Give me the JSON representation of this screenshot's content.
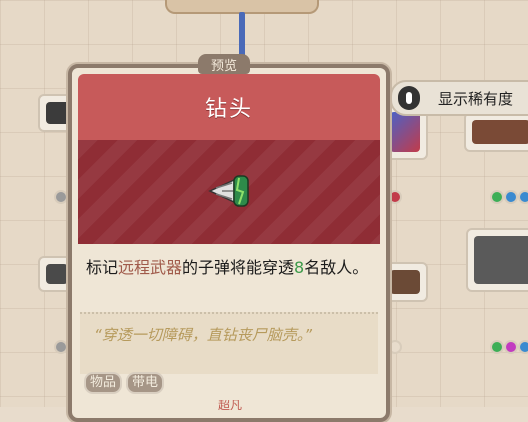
{
  "rarity_toggle": {
    "label": "显示稀有度",
    "icon": "toggle-switch-icon"
  },
  "tooltip": {
    "preview_tab": "预览",
    "title": "钻头",
    "icon": "drill-bit-icon",
    "description": {
      "part1": "标记",
      "keyword": "远程武器",
      "part2": "的子弹将能穿透",
      "number": "8",
      "part3": "名敌人。"
    },
    "flavor": "“穿透一切障碍，直钻丧尸脑壳。”",
    "tags": [
      "物品",
      "带电"
    ],
    "rarity_peek": "超凡"
  },
  "colors": {
    "header": "#c75a5a",
    "art_bg": "#8f2d35",
    "keyword": "#a05a4a",
    "number": "#3c9a4a",
    "flavor": "#b69a5c"
  }
}
